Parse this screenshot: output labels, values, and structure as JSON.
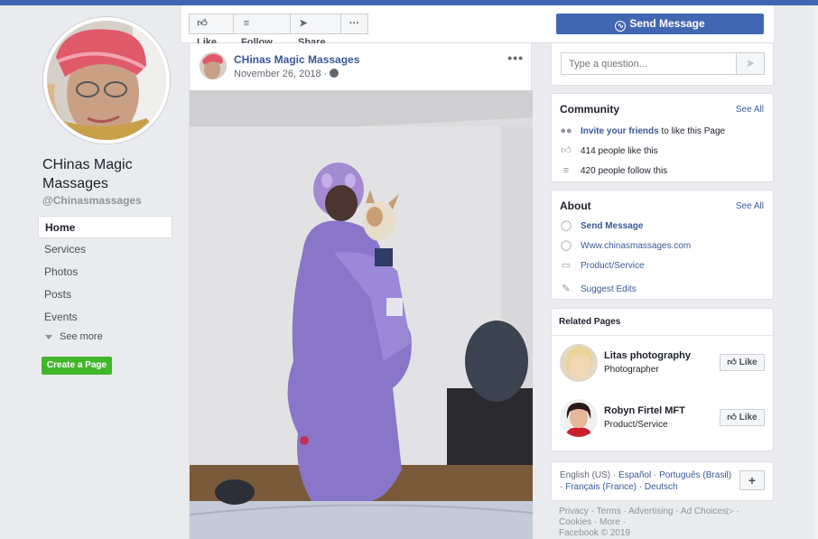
{
  "page": {
    "name": "CHinas Magic Massages",
    "handle": "@Chinasmassages"
  },
  "nav": {
    "items": [
      {
        "label": "Home"
      },
      {
        "label": "Services"
      },
      {
        "label": "Photos"
      },
      {
        "label": "Posts"
      },
      {
        "label": "Events"
      }
    ],
    "see_more": "See more",
    "create_page": "Create a Page"
  },
  "actions": {
    "like": "Like",
    "follow": "Follow",
    "share": "Share",
    "more": "···",
    "send_message": "Send Message"
  },
  "post": {
    "author": "CHinas Magic Massages",
    "date": "November 26, 2018 · ",
    "menu": "•••"
  },
  "question": {
    "placeholder": "Type a question..."
  },
  "community": {
    "title": "Community",
    "see_all": "See All",
    "invite_link": "Invite your friends",
    "invite_rest": " to like this Page",
    "likes": "414 people like this",
    "follows": "420 people follow this"
  },
  "about": {
    "title": "About",
    "see_all": "See All",
    "send_message": "Send Message",
    "website": "Www.chinasmassages.com",
    "category": "Product/Service",
    "suggest": "Suggest Edits"
  },
  "related": {
    "title": "Related Pages",
    "pages": [
      {
        "name": "Litas photography",
        "category": "Photographer",
        "like": "Like"
      },
      {
        "name": "Robyn Firtel MFT",
        "category": "Product/Service",
        "like": "Like"
      }
    ]
  },
  "languages": {
    "current": "English (US)",
    "others": [
      "Español",
      "Português (Brasil)",
      "Français (France)",
      "Deutsch"
    ],
    "plus": "+"
  },
  "footer": {
    "links": [
      "Privacy",
      "Terms",
      "Advertising",
      "Ad Choices",
      "Cookies",
      "More"
    ],
    "copyright": "Facebook © 2019"
  },
  "colors": {
    "brand": "#4267b2",
    "link": "#385898",
    "create_green": "#42b72a",
    "background": "#e9ebee"
  },
  "icons": {
    "like": "thumbs-up-icon",
    "follow": "rss-icon",
    "share": "share-arrow-icon",
    "messenger": "messenger-icon",
    "globe": "globe-icon",
    "send": "paper-plane-icon",
    "pencil": "pencil-icon"
  }
}
